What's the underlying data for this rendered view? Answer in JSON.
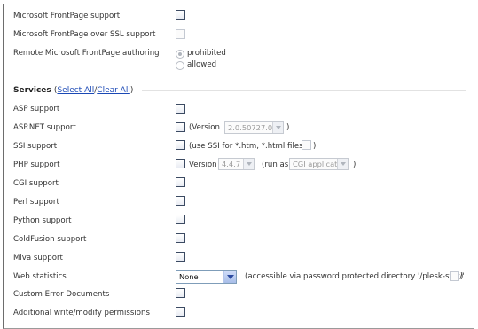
{
  "frontpage": {
    "fp_support": "Microsoft FrontPage support",
    "fp_ssl_support": "Microsoft FrontPage over SSL support",
    "fp_remote_authoring": "Remote Microsoft FrontPage authoring",
    "remote_options": {
      "prohibited": "prohibited",
      "allowed": "allowed",
      "selected": "prohibited"
    }
  },
  "services": {
    "title": "Services",
    "open_paren": "(",
    "select_all": "Select All",
    "slash": "/",
    "clear_all": "Clear All",
    "close_paren": ")",
    "asp": "ASP support",
    "aspnet": "ASP.NET support",
    "aspnet_version_prefix": "(Version",
    "aspnet_version_value": "2.0.50727.0",
    "aspnet_version_suffix": ")",
    "ssi": "SSI support",
    "ssi_files_text": "(use SSI for *.htm, *.html files",
    "ssi_suffix": ")",
    "php": "PHP support",
    "php_version_label": "Version",
    "php_version_value": "4.4.7",
    "php_run_as_label": "(run as",
    "php_run_as_value": "CGI application",
    "php_suffix": ")",
    "cgi": "CGI support",
    "perl": "Perl support",
    "python": "Python support",
    "coldfusion": "ColdFusion support",
    "miva": "Miva support",
    "web_stats": "Web statistics",
    "web_stats_value": "None",
    "web_stats_note": "(accessible via password protected directory '/plesk-stat/'",
    "web_stats_suffix": ")",
    "custom_errors": "Custom Error Documents",
    "write_modify": "Additional write/modify permissions"
  },
  "icons": {
    "checkbox": "checkbox-icon",
    "radio": "radio-icon",
    "dropdown": "chevron-down-icon"
  },
  "colors": {
    "link": "#1a48b5",
    "checkbox_border": "#3b4a62",
    "select_arrow": "#2b4aa0"
  }
}
